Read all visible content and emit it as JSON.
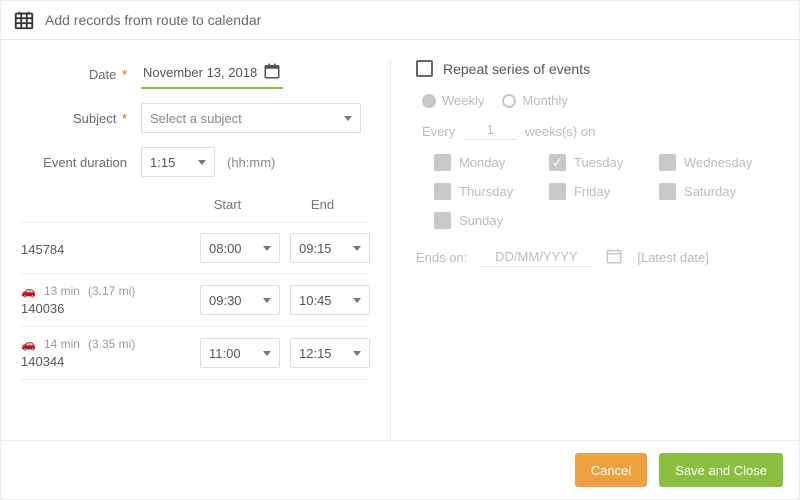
{
  "title": "Add records from route to calendar",
  "form": {
    "date_label": "Date",
    "date_value": "November 13, 2018",
    "subject_label": "Subject",
    "subject_placeholder": "Select a subject",
    "duration_label": "Event duration",
    "duration_value": "1:15",
    "duration_hint": "(hh:mm)"
  },
  "table": {
    "start_header": "Start",
    "end_header": "End",
    "rows": [
      {
        "record": "145784",
        "travel_mins": "",
        "travel_dist": "",
        "start": "08:00",
        "end": "09:15"
      },
      {
        "record": "140036",
        "travel_mins": "13 min",
        "travel_dist": "(3.17 mi)",
        "start": "09:30",
        "end": "10:45"
      },
      {
        "record": "140344",
        "travel_mins": "14 min",
        "travel_dist": "(3.35 mi)",
        "start": "11:00",
        "end": "12:15"
      }
    ]
  },
  "repeat": {
    "label": "Repeat series of events",
    "freq_weekly": "Weekly",
    "freq_monthly": "Monthly",
    "every_label": "Every",
    "every_value": "1",
    "every_unit": "weeks(s) on",
    "days": {
      "mon": "Monday",
      "tue": "Tuesday",
      "wed": "Wednesday",
      "thu": "Thursday",
      "fri": "Friday",
      "sat": "Saturday",
      "sun": "Sunday"
    },
    "tue_checked": true,
    "ends_label": "Ends on:",
    "ends_placeholder": "DD/MM/YYYY",
    "latest_label": "[Latest date]"
  },
  "buttons": {
    "cancel": "Cancel",
    "save": "Save and Close"
  }
}
